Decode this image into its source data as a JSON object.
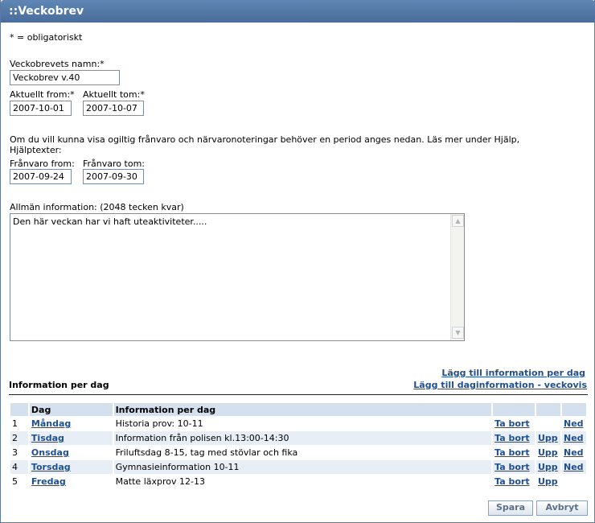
{
  "title": "::Veckobrev",
  "required_note": "* = obligatoriskt",
  "name": {
    "label": "Veckobrevets namn:*",
    "value": "Veckobrev v.40"
  },
  "period": {
    "from_label": "Aktuellt from:*",
    "from_value": "2007-10-01",
    "to_label": "Aktuellt tom:*",
    "to_value": "2007-10-07"
  },
  "absence_note": "Om du vill kunna visa ogiltig frånvaro och närvaronoteringar behöver en period anges nedan. Läs mer under Hjälp,",
  "absence_note2": "Hjälptexter:",
  "absence": {
    "from_label": "Frånvaro from:",
    "from_value": "2007-09-24",
    "to_label": "Frånvaro tom:",
    "to_value": "2007-09-30"
  },
  "general_info": {
    "label": "Allmän information: (2048 tecken kvar)",
    "value": "Den här veckan har vi haft uteaktiviteter....."
  },
  "per_day": {
    "heading": "Information per dag",
    "add_link": "Lägg till information per dag",
    "add_weekly_link": "Lägg till daginformation - veckovis",
    "columns": [
      "",
      "Dag",
      "Information per dag",
      "",
      "",
      ""
    ],
    "rows": [
      {
        "num": "1",
        "day": "Måndag",
        "info": "Historia prov: 10-11",
        "remove": "Ta bort",
        "up": "",
        "down": "Ned"
      },
      {
        "num": "2",
        "day": "Tisdag",
        "info": "Information från polisen kl.13:00-14:30",
        "remove": "Ta bort",
        "up": "Upp",
        "down": "Ned"
      },
      {
        "num": "3",
        "day": "Onsdag",
        "info": "Friluftsdag 8-15, tag med stövlar och fika",
        "remove": "Ta bort",
        "up": "Upp",
        "down": "Ned"
      },
      {
        "num": "4",
        "day": "Torsdag",
        "info": "Gymnasieinformation 10-11",
        "remove": "Ta bort",
        "up": "Upp",
        "down": "Ned"
      },
      {
        "num": "5",
        "day": "Fredag",
        "info": "Matte läxprov 12-13",
        "remove": "Ta bort",
        "up": "Upp",
        "down": ""
      }
    ]
  },
  "buttons": {
    "save": "Spara",
    "cancel": "Avbryt"
  }
}
